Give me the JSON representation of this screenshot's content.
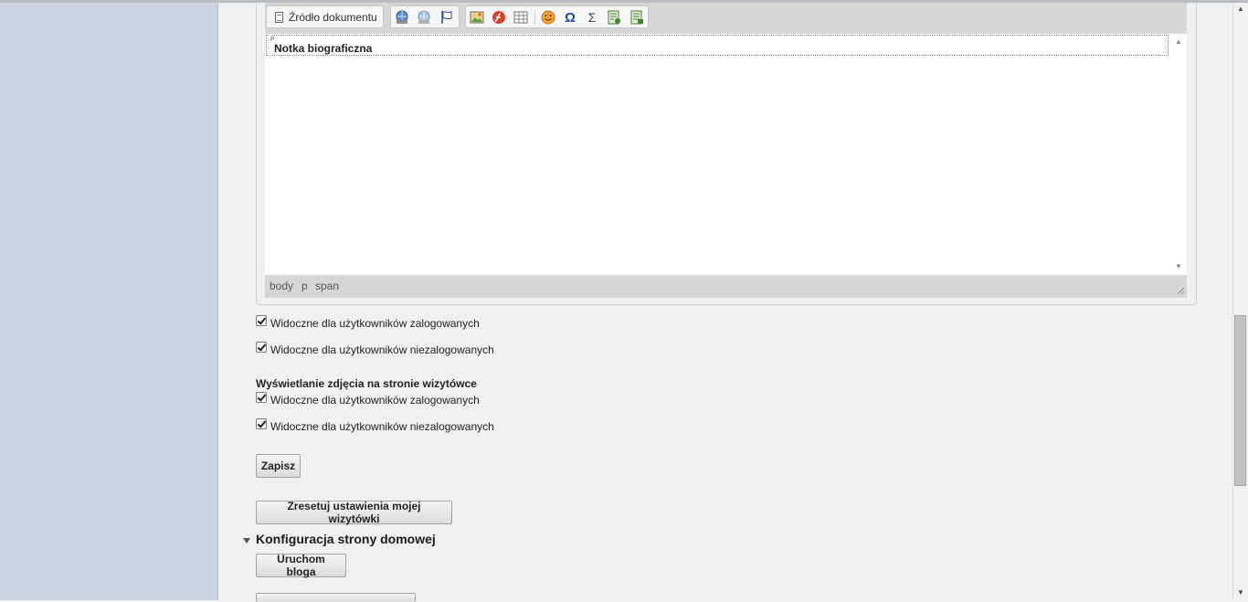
{
  "editor": {
    "toolbar": {
      "source_label": "Źródło dokumentu",
      "link_icons": [
        "link-icon",
        "unlink-icon",
        "anchor-icon"
      ],
      "insert_icons": [
        "image-icon",
        "flash-icon",
        "table-icon",
        "smiley-icon",
        "special-char-icon",
        "sigma-icon",
        "template-add-icon",
        "template-icon"
      ]
    },
    "content": {
      "p_marker": "P",
      "text": "Notka biograficzna"
    },
    "path": [
      "body",
      "p",
      "span"
    ]
  },
  "bio_visibility": {
    "logged_in": "Widoczne dla użytkowników zalogowanych",
    "logged_out": "Widoczne dla użytkowników niezalogowanych"
  },
  "photo_section": {
    "title": "Wyświetlanie zdjęcia na stronie wizytówce",
    "logged_in": "Widoczne dla użytkowników zalogowanych",
    "logged_out": "Widoczne dla użytkowników niezalogowanych"
  },
  "buttons": {
    "save": "Zapisz",
    "reset": "Zresetuj ustawienia mojej wizytówki",
    "start_blog": "Uruchom bloga"
  },
  "homepage_section": {
    "title": "Konfiguracja strony domowej"
  },
  "colors": {
    "left_panel": "#cbd2dc",
    "content_bg": "#eef0f2",
    "editor_chrome": "#d6d6d6"
  }
}
